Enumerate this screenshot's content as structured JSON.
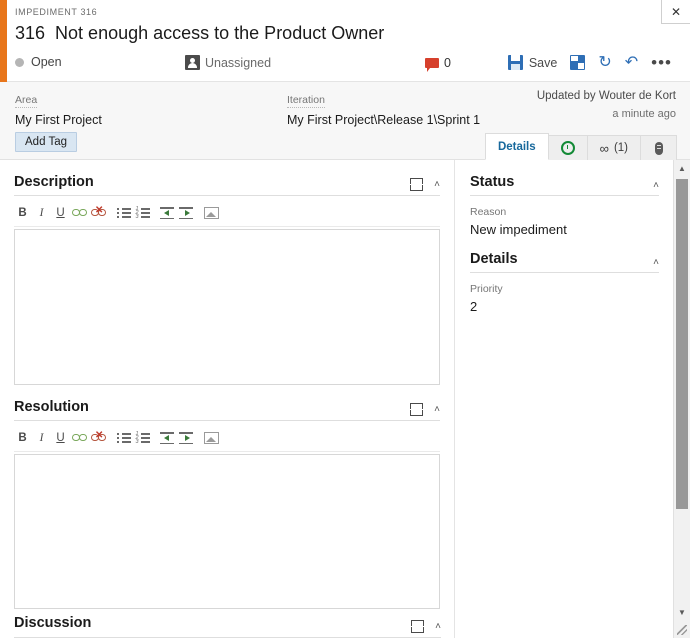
{
  "window": {
    "close_label": "✕"
  },
  "header": {
    "work_item_type": "IMPEDIMENT 316",
    "id": "316",
    "title": "Not enough access to the Product Owner",
    "state": "Open",
    "assignee": "Unassigned",
    "comment_count": "0",
    "save_label": "Save",
    "refresh_glyph": "↻",
    "undo_glyph": "↶",
    "more_glyph": "•••"
  },
  "info": {
    "area_label": "Area",
    "area_value": "My First Project",
    "iteration_label": "Iteration",
    "iteration_value": "My First Project\\Release 1\\Sprint 1",
    "updated_by": "Updated by Wouter de Kort",
    "updated_when": "a minute ago",
    "add_tag_label": "Add Tag"
  },
  "tabs": [
    {
      "label": "Details",
      "icon": "details-text",
      "active": true
    },
    {
      "label": "",
      "icon": "history-clock-icon",
      "active": false
    },
    {
      "label": "(1)",
      "icon": "link-icon",
      "active": false
    },
    {
      "label": "",
      "icon": "attachment-icon",
      "active": false
    }
  ],
  "editor_toolbar": {
    "bold": "B",
    "italic": "I",
    "underline": "U",
    "link": "link-icon",
    "unlink": "unlink-icon",
    "bullet_list": "bullet-list-icon",
    "numbered_list": "numbered-list-icon",
    "outdent": "outdent-icon",
    "indent": "indent-icon",
    "image": "insert-image-icon",
    "unlink_x": "✕",
    "ol_markers": [
      "1",
      "2",
      "3"
    ]
  },
  "sections": {
    "description": {
      "title": "Description",
      "content": "",
      "chevron": "˄"
    },
    "resolution": {
      "title": "Resolution",
      "content": "",
      "chevron": "˄"
    },
    "discussion": {
      "title": "Discussion",
      "chevron": "˄"
    }
  },
  "right_panel": {
    "status": {
      "title": "Status",
      "chevron": "˄",
      "reason_label": "Reason",
      "reason_value": "New impediment"
    },
    "details": {
      "title": "Details",
      "chevron": "˄",
      "priority_label": "Priority",
      "priority_value": "2"
    }
  },
  "scrollbar": {
    "up_glyph": "▲",
    "down_glyph": "▼"
  },
  "colors": {
    "accent": "#e8761b",
    "link": "#2e6eb5",
    "tab_active_text": "#17689c",
    "comment_icon": "#d6402c"
  }
}
